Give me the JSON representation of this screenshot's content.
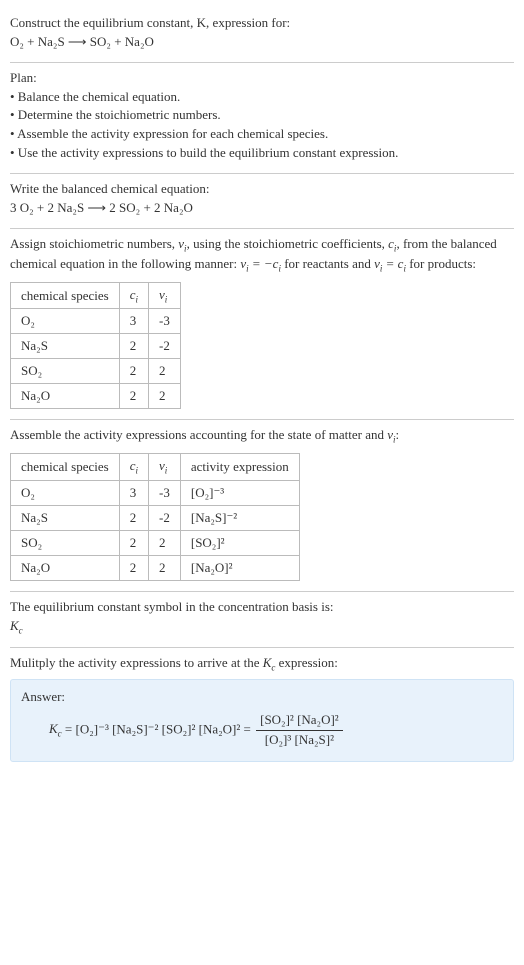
{
  "intro": {
    "l1": "Construct the equilibrium constant, K, expression for:",
    "eq1": "O₂ + Na₂S ⟶ SO₂ + Na₂O"
  },
  "plan": {
    "title": "Plan:",
    "b1": "• Balance the chemical equation.",
    "b2": "• Determine the stoichiometric numbers.",
    "b3": "• Assemble the activity expression for each chemical species.",
    "b4": "• Use the activity expressions to build the equilibrium constant expression."
  },
  "balanced": {
    "title": "Write the balanced chemical equation:",
    "eq": "3 O₂ + 2 Na₂S ⟶ 2 SO₂ + 2 Na₂O"
  },
  "stoich_text": {
    "p1a": "Assign stoichiometric numbers, ",
    "p1b": ", using the stoichiometric coefficients, ",
    "p1c": ", from the balanced chemical equation in the following manner: ",
    "p1d": " for reactants and ",
    "p1e": " for products:"
  },
  "table1": {
    "h1": "chemical species",
    "h2": "cᵢ",
    "h3": "νᵢ",
    "rows": [
      {
        "sp": "O₂",
        "c": "3",
        "v": "-3"
      },
      {
        "sp": "Na₂S",
        "c": "2",
        "v": "-2"
      },
      {
        "sp": "SO₂",
        "c": "2",
        "v": "2"
      },
      {
        "sp": "Na₂O",
        "c": "2",
        "v": "2"
      }
    ]
  },
  "activity_intro": "Assemble the activity expressions accounting for the state of matter and νᵢ:",
  "table2": {
    "h1": "chemical species",
    "h2": "cᵢ",
    "h3": "νᵢ",
    "h4": "activity expression",
    "rows": [
      {
        "sp": "O₂",
        "c": "3",
        "v": "-3",
        "a": "[O₂]⁻³"
      },
      {
        "sp": "Na₂S",
        "c": "2",
        "v": "-2",
        "a": "[Na₂S]⁻²"
      },
      {
        "sp": "SO₂",
        "c": "2",
        "v": "2",
        "a": "[SO₂]²"
      },
      {
        "sp": "Na₂O",
        "c": "2",
        "v": "2",
        "a": "[Na₂O]²"
      }
    ]
  },
  "kc_symbol": {
    "line1": "The equilibrium constant symbol in the concentration basis is:",
    "sym": "K",
    "sub": "c"
  },
  "multiply": {
    "line": "Mulitply the activity expressions to arrive at the ",
    "kc": "K",
    "kcsub": "c",
    "line2": " expression:"
  },
  "answer": {
    "label": "Answer:",
    "lhs": "Kc = [O₂]⁻³ [Na₂S]⁻² [SO₂]² [Na₂O]² =",
    "num": "[SO₂]² [Na₂O]²",
    "den": "[O₂]³ [Na₂S]²"
  },
  "chart_data": {
    "type": "table",
    "tables": [
      {
        "title": "stoichiometric numbers",
        "columns": [
          "chemical species",
          "c_i",
          "ν_i"
        ],
        "rows": [
          [
            "O2",
            3,
            -3
          ],
          [
            "Na2S",
            2,
            -2
          ],
          [
            "SO2",
            2,
            2
          ],
          [
            "Na2O",
            2,
            2
          ]
        ]
      },
      {
        "title": "activity expressions",
        "columns": [
          "chemical species",
          "c_i",
          "ν_i",
          "activity expression"
        ],
        "rows": [
          [
            "O2",
            3,
            -3,
            "[O2]^-3"
          ],
          [
            "Na2S",
            2,
            -2,
            "[Na2S]^-2"
          ],
          [
            "SO2",
            2,
            2,
            "[SO2]^2"
          ],
          [
            "Na2O",
            2,
            2,
            "[Na2O]^2"
          ]
        ]
      }
    ],
    "balanced_equation": "3 O2 + 2 Na2S -> 2 SO2 + 2 Na2O",
    "Kc": "([SO2]^2 [Na2O]^2) / ([O2]^3 [Na2S]^2)"
  }
}
